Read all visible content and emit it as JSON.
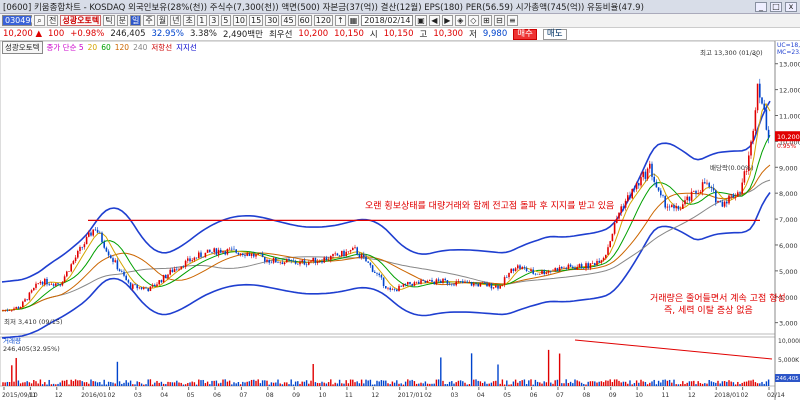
{
  "window": {
    "title": "[0600] 키움종합차트 - KOSDAQ 외국인보유(28%(천)) 주식수(7,300(천)) 액면(500) 자본금(37(억)) 결산(12월) EPS(180) PER(56.59) 시가총액(745(억)) 유동비율(47.9)",
    "buttons": [
      "_",
      "□",
      "x"
    ]
  },
  "toolbar": {
    "code": "030490",
    "chart_type_label": "전",
    "stock_name": "성광오토텍",
    "period_buttons": [
      "틱",
      "분",
      "일",
      "주",
      "월",
      "년",
      "초"
    ],
    "interval_buttons": [
      "1",
      "3",
      "5",
      "10",
      "15",
      "30",
      "45",
      "60",
      "120",
      "↑"
    ],
    "date": "2018/02/14",
    "right_buttons": [
      "▣",
      "◀",
      "▶",
      "◈",
      "◇",
      "⊞",
      "⊟",
      "≡"
    ]
  },
  "quote": {
    "price": "10,200",
    "arrow": "▲",
    "change_label": "100",
    "change": "+0.98%",
    "volume": "246,405",
    "ratio1": "32.95%",
    "ratio2": "3.38%",
    "amount": "2,490백만",
    "best_ask_label": "최우선",
    "best_ask": "10,200",
    "best_bid": "10,150",
    "open_label": "시",
    "open": "10,150",
    "high_label": "고",
    "high": "10,300",
    "low_label": "저",
    "low": "9,980",
    "buy_label": "매수",
    "sell_label": "매도"
  },
  "legend": {
    "name": "성광오토텍",
    "items": [
      "종가 단순 5",
      "20",
      "60",
      "120",
      "240",
      "저항선",
      "지지선"
    ],
    "colors": [
      "#cc00cc",
      "#d4a400",
      "#00a000",
      "#cc6600",
      "#888888",
      "#cc0000",
      "#0000cc"
    ]
  },
  "colors": {
    "up_candle": "#e00000",
    "down_candle": "#0044cc",
    "bollinger": "#1f3fd0",
    "resistance": "#e00000",
    "volume_trend": "#e00000"
  },
  "chart_data": {
    "type": "candlestick",
    "x_labels": [
      "2015/09/10",
      "11",
      "12",
      "2016/01",
      "02",
      "03",
      "04",
      "05",
      "06",
      "07",
      "08",
      "09",
      "10",
      "11",
      "12",
      "2017/01",
      "02",
      "03",
      "04",
      "05",
      "06",
      "07",
      "08",
      "09",
      "10",
      "11",
      "12",
      "2018/01",
      "02",
      "02/14"
    ],
    "y_ticks": [
      3000,
      4000,
      5000,
      6000,
      7000,
      8000,
      9000,
      10000,
      11000,
      12000,
      13000
    ],
    "ylim": [
      2600,
      13800
    ],
    "close_path": [
      [
        0,
        3450
      ],
      [
        20,
        3600
      ],
      [
        40,
        4600
      ],
      [
        60,
        4500
      ],
      [
        80,
        5800
      ],
      [
        95,
        6700
      ],
      [
        110,
        5600
      ],
      [
        130,
        4400
      ],
      [
        150,
        4300
      ],
      [
        175,
        5100
      ],
      [
        200,
        5600
      ],
      [
        220,
        5800
      ],
      [
        245,
        5700
      ],
      [
        270,
        5400
      ],
      [
        300,
        5300
      ],
      [
        330,
        5500
      ],
      [
        355,
        5800
      ],
      [
        370,
        5200
      ],
      [
        390,
        4200
      ],
      [
        410,
        4500
      ],
      [
        440,
        4600
      ],
      [
        470,
        4500
      ],
      [
        500,
        4400
      ],
      [
        515,
        5200
      ],
      [
        535,
        4900
      ],
      [
        560,
        5100
      ],
      [
        590,
        5200
      ],
      [
        605,
        5600
      ],
      [
        620,
        7400
      ],
      [
        635,
        8200
      ],
      [
        650,
        9000
      ],
      [
        660,
        7800
      ],
      [
        675,
        7300
      ],
      [
        690,
        7800
      ],
      [
        705,
        8400
      ],
      [
        720,
        7600
      ],
      [
        740,
        8100
      ],
      [
        750,
        9500
      ],
      [
        758,
        12400
      ],
      [
        765,
        10800
      ],
      [
        770,
        10200
      ]
    ],
    "annotations": {
      "high_label": "최고 13,300 (01/30)",
      "low_label": "최저 3,410 (09/15)",
      "ex_dividend_label": "배당락(0.00%)",
      "note1": "오랜 횡보상태를 대량거래와 함께 전고점 돌파 후 지지를 받고 있음",
      "note2_line1": "거래량은 줄어들면서 계속 고점 형성",
      "note2_line2": "즉, 세력 이탈 증상 없음",
      "upper_band": "UC=18,12",
      "middle_band": "MC=23.39",
      "current_price": "10,200",
      "current_ratio": "0.95%"
    },
    "resistance_level": 6950,
    "volume": {
      "label": "거래량",
      "value_label": "246,405(32.95%)",
      "y_ticks": [
        "10,000K",
        "5,000K",
        "246,405"
      ],
      "ylim": [
        0,
        10000
      ]
    }
  }
}
